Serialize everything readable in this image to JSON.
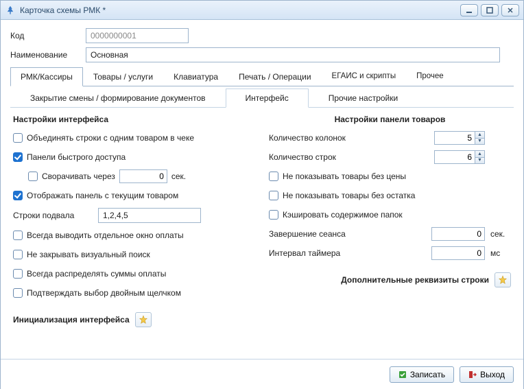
{
  "window": {
    "title": "Карточка схемы РМК *"
  },
  "form": {
    "code_label": "Код",
    "code_value": "0000000001",
    "name_label": "Наименование",
    "name_value": "Основная"
  },
  "tabs_primary": [
    "РМК/Кассиры",
    "Товары / услуги",
    "Клавиатура",
    "Печать / Операции",
    "ЕГАИС и скрипты",
    "Прочее"
  ],
  "tabs_secondary": [
    "Закрытие смены / формирование документов",
    "Интерфейс",
    "Прочие настройки"
  ],
  "left": {
    "section_title": "Настройки интерфейса",
    "merge_lines": "Объединять строки с одним товаром в чеке",
    "quick_panels": "Панели быстрого доступа",
    "collapse_after": "Сворачивать через",
    "collapse_value": "0",
    "sec": "сек.",
    "show_current": "Отображать панель с текущим товаром",
    "footer_rows_label": "Строки подвала",
    "footer_rows_value": "1,2,4,5",
    "always_pay_window": "Всегда выводить отдельное окно оплаты",
    "keep_visual_search": "Не закрывать визуальный поиск",
    "always_distribute": "Всегда распределять суммы оплаты",
    "confirm_dblclick": "Подтверждать выбор двойным щелчком",
    "init_label": "Инициализация интерфейса"
  },
  "right": {
    "section_title": "Настройки панели товаров",
    "cols_label": "Количество колонок",
    "cols_value": "5",
    "rows_label": "Количество строк",
    "rows_value": "6",
    "hide_no_price": "Не показывать товары без цены",
    "hide_no_stock": "Не показывать товары без остатка",
    "cache_folders": "Кэшировать содержимое папок",
    "session_end_label": "Завершение сеанса",
    "session_end_value": "0",
    "sec": "сек.",
    "timer_label": "Интервал таймера",
    "timer_value": "0",
    "ms": "мс",
    "extra_label": "Дополнительные реквизиты строки"
  },
  "footer": {
    "save": "Записать",
    "exit": "Выход"
  }
}
